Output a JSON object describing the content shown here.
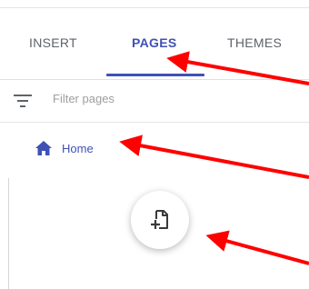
{
  "tabs": [
    {
      "label": "INSERT",
      "active": false
    },
    {
      "label": "PAGES",
      "active": true
    },
    {
      "label": "THEMES",
      "active": false
    }
  ],
  "filter": {
    "placeholder": "Filter pages",
    "value": "",
    "icon": "filter-list-icon"
  },
  "pages": [
    {
      "label": "Home",
      "icon": "home-icon"
    }
  ],
  "fab": {
    "icon": "add-page-icon"
  },
  "colors": {
    "accent": "#3f51b5",
    "annotation_arrow": "#ff0000",
    "divider": "#e0e0e0"
  }
}
